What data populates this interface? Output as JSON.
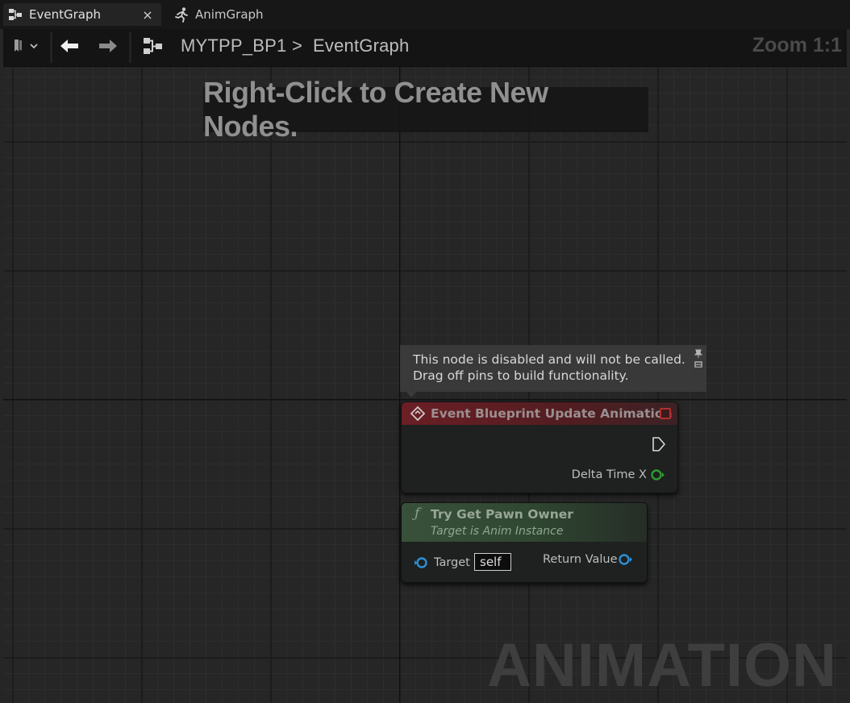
{
  "tabs": [
    {
      "label": "EventGraph",
      "icon": "graph-icon",
      "active": true,
      "close": "×"
    },
    {
      "label": "AnimGraph",
      "icon": "running-figure-icon",
      "active": false
    }
  ],
  "toolbar": {
    "bookmark_icon": "bookmark-icon",
    "back_icon": "arrow-left-icon",
    "forward_icon": "arrow-right-icon",
    "graph_icon": "graph-icon",
    "breadcrumb": {
      "blueprint": "MYTPP_BP1",
      "separator": ">",
      "graph": "EventGraph"
    },
    "zoom": "Zoom 1:1"
  },
  "canvas": {
    "hint": "Right-Click to Create New Nodes.",
    "watermark": "ANIMATION"
  },
  "comment": {
    "line1": "This node is disabled and will not be called.",
    "line2": "Drag off pins to build functionality."
  },
  "event_node": {
    "title": "Event Blueprint Update Animation",
    "pin_delta": "Delta Time X",
    "header_color": "#6a1f25",
    "float_pin_color": "#2f9a2f"
  },
  "function_node": {
    "symbol": "ƒ",
    "title": "Try Get Pawn Owner",
    "subtitle": "Target is Anim Instance",
    "target_label": "Target",
    "target_value": "self",
    "return_label": "Return Value",
    "header_color": "#39513b",
    "object_pin_color": "#2e8fd6"
  }
}
